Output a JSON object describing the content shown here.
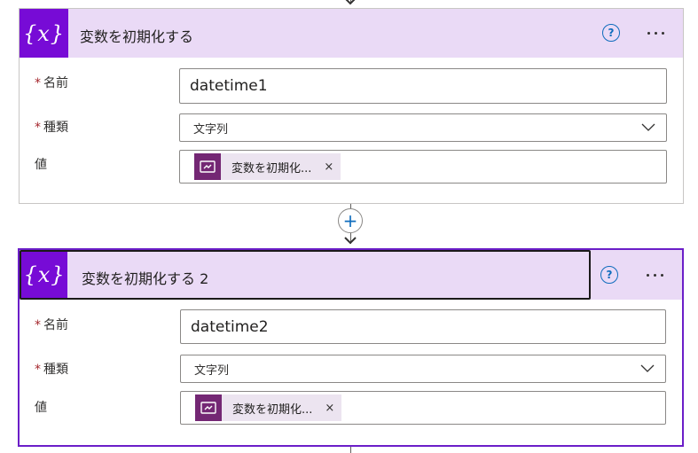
{
  "step1": {
    "icon_text": "{x}",
    "title": "変数を初期化する",
    "help_icon": "question-circle-icon",
    "more_icon": "ellipsis-icon",
    "name_label": "名前",
    "name_value": "datetime1",
    "type_label": "種類",
    "type_value": "文字列",
    "value_label": "値",
    "token_label": "変数を初期化...",
    "token_close": "×"
  },
  "connector": {
    "add_label": "+"
  },
  "step2": {
    "icon_text": "{x}",
    "title": "変数を初期化する 2",
    "help_icon": "question-circle-icon",
    "more_icon": "ellipsis-icon",
    "name_label": "名前",
    "name_value": "datetime2",
    "type_label": "種類",
    "type_value": "文字列",
    "value_label": "値",
    "token_label": "変数を初期化...",
    "token_close": "×"
  },
  "required_mark": "*",
  "help_glyph": "?",
  "colors": {
    "header_bg": "#eadaf6",
    "icon_bg": "#770bd6",
    "selected_border": "#6b1ec8",
    "token_icon_bg": "#742774",
    "token_bg": "#ece4f0",
    "accent": "#0f6cbd",
    "required": "#a4262c"
  }
}
